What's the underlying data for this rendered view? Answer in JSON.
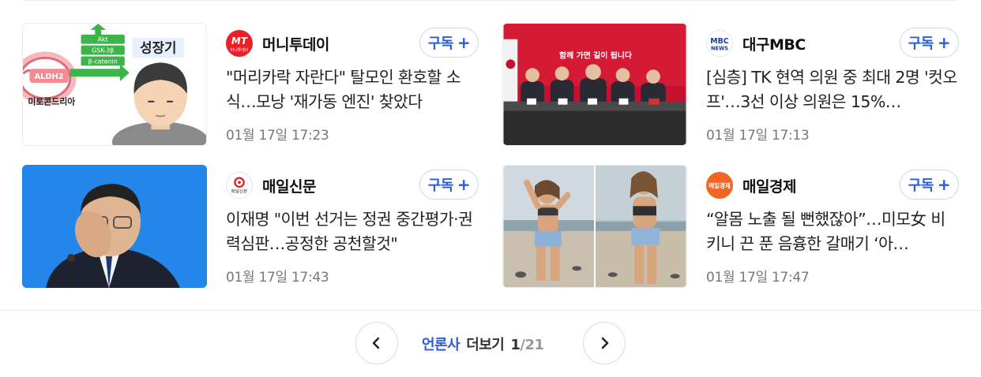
{
  "subscribe_label": "구독",
  "subscribe_plus": "+",
  "articles": [
    {
      "press": "머니투데이",
      "title": "\"머리카락 자란다\" 탈모인 환호할 소식…모낭 '재가동 엔진' 찾았다",
      "time": "01월 17일 17:23",
      "thumb_text": {
        "akt": "Akt",
        "gsk": "GSK-3β",
        "cat": "β-catenin",
        "aldh": "ALDH2",
        "mito": "미토콘드리아",
        "grow": "성장기"
      },
      "logo_text": {
        "main": "MT",
        "sub": "머니투데이"
      }
    },
    {
      "press": "대구MBC",
      "title": "[심층] TK 현역 의원 중 최대 2명 '컷오프'…3선 이상 의원은 15%…",
      "time": "01월 17일 17:13",
      "thumb_text": {
        "banner": "함께 가면 길이 됩니다"
      },
      "logo_text": {
        "main": "MBC",
        "sub": "NEWS"
      }
    },
    {
      "press": "매일신문",
      "title": "이재명 \"이번 선거는 정권 중간평가·권력심판…공정한 공천할것\"",
      "time": "01월 17일 17:43",
      "logo_text": {
        "sub": "매일신문"
      }
    },
    {
      "press": "매일경제",
      "title": "“알몸 노출 될 뻔했잖아”…미모女 비키니 끈 푼 음흉한 갈매기 ‘아…",
      "time": "01월 17일 17:47",
      "logo_text": {
        "main": "매일경제"
      }
    }
  ],
  "pager": {
    "press_label": "언론사",
    "more_label": "더보기",
    "current": "1",
    "total": "/21"
  },
  "colors": {
    "accent": "#2a5ed8",
    "mt_red": "#e8202a",
    "mbc_blue": "#1d3d8f",
    "maeil_orange": "#f26522"
  }
}
